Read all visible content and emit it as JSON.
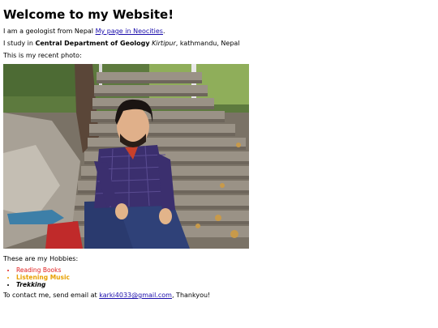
{
  "page": {
    "heading": "Welcome to my Website!",
    "intro_text": "I am a geologist from Nepal ",
    "intro_link": "My page in Neocities",
    "intro_end": ".",
    "study_prefix": "I study in ",
    "study_department": "Central Department of Geology",
    "study_space": " ",
    "study_place": "Kirtipur",
    "study_suffix": ", kathmandu, Nepal",
    "photo_caption": "This is my recent photo:",
    "hobbies_title": "These are my Hobbies:",
    "hobbies": [
      {
        "label": "Reading Books",
        "color": "#e02020"
      },
      {
        "label": "Listening Music",
        "color": "#e8a000"
      },
      {
        "label": "Trekking",
        "color": "#000000"
      }
    ],
    "contact_prefix": "To contact me, send email at ",
    "contact_email": "karki4033@gmail.com",
    "contact_suffix": ", Thankyou!"
  },
  "colors": {
    "link": "#1a0dab",
    "text": "#000000",
    "background": "#ffffff"
  }
}
